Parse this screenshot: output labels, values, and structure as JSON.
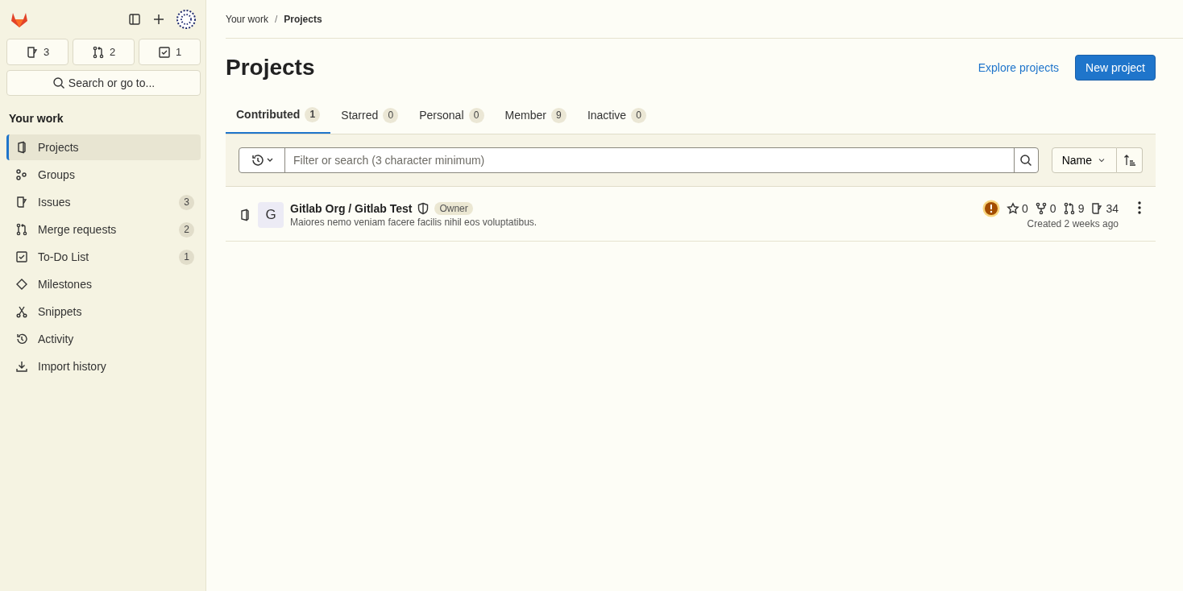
{
  "sidebar": {
    "counters": [
      "3",
      "2",
      "1"
    ],
    "search": {
      "label": "Search or go to..."
    },
    "section_title": "Your work",
    "items": [
      {
        "label": "Projects",
        "selected": true
      },
      {
        "label": "Groups",
        "selected": false
      },
      {
        "label": "Issues",
        "count": "3",
        "selected": false
      },
      {
        "label": "Merge requests",
        "count": "2",
        "selected": false
      },
      {
        "label": "To-Do List",
        "count": "1",
        "selected": false
      },
      {
        "label": "Milestones",
        "selected": false
      },
      {
        "label": "Snippets",
        "selected": false
      },
      {
        "label": "Activity",
        "selected": false
      },
      {
        "label": "Import history",
        "selected": false
      }
    ]
  },
  "breadcrumb": [
    "Your work",
    "/",
    "Projects"
  ],
  "page_title": "Projects",
  "actions": {
    "explore": "Explore projects",
    "new": "New project"
  },
  "tabs": [
    {
      "label": "Contributed",
      "count": "1",
      "selected": true
    },
    {
      "label": "Starred",
      "count": "0",
      "selected": false
    },
    {
      "label": "Personal",
      "count": "0",
      "selected": false
    },
    {
      "label": "Member",
      "count": "9",
      "selected": false
    },
    {
      "label": "Inactive",
      "count": "0",
      "selected": false
    }
  ],
  "filter": {
    "placeholder": "Filter or search (3 character minimum)",
    "sort": "Name"
  },
  "projects": [
    {
      "avatar": "G",
      "name": "Gitlab Org / Gitlab Test",
      "role": "Owner",
      "description": "Maiores nemo veniam facere facilis nihil eos voluptatibus.",
      "stars": "0",
      "forks": "0",
      "merge_requests": "9",
      "issues": "34",
      "created": "Created 2 weeks ago"
    }
  ]
}
